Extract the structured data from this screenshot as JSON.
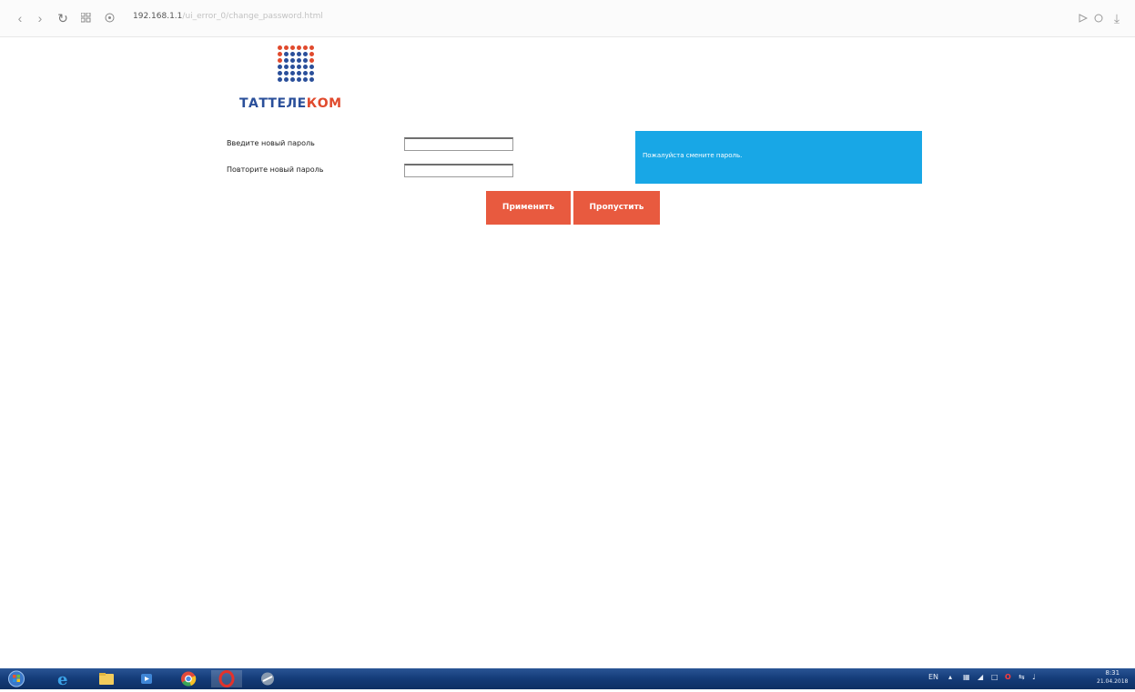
{
  "browser": {
    "url_host": "192.168.1.1",
    "url_path": "/ui_error_0/change_password.html",
    "back_icon": "chevron-left-icon",
    "forward_icon": "chevron-right-icon",
    "reload_icon": "reload-icon",
    "grid_icon": "speed-dial-grid-icon",
    "security_icon": "site-info-icon",
    "send_icon": "send-icon",
    "heart_icon": "heart-icon",
    "download_icon": "download-icon"
  },
  "logo": {
    "text_blue": "ТАТТЕЛЕ",
    "text_red": "КОМ",
    "dot_color_red": "#e04a2d",
    "dot_color_blue": "#2a4f9a"
  },
  "form": {
    "new_password_label": "Введите новый пароль",
    "repeat_password_label": "Повторите новый пароль",
    "new_password_value": "",
    "repeat_password_value": "",
    "apply_button": "Применить",
    "skip_button": "Пропустить"
  },
  "info_box": {
    "text": "Пожалуйста смените пароль.",
    "color": "#18a7e6"
  },
  "taskbar": {
    "items": [
      "start-orb-icon",
      "internet-explorer-icon",
      "file-explorer-icon",
      "media-player-icon",
      "chrome-icon",
      "opera-icon",
      "system-tool-icon"
    ],
    "language": "EN",
    "clock_time": "8:31",
    "clock_date": "21.04.2018"
  },
  "colors": {
    "accent_button": "#e85a3f",
    "info_blue": "#18a7e6"
  }
}
